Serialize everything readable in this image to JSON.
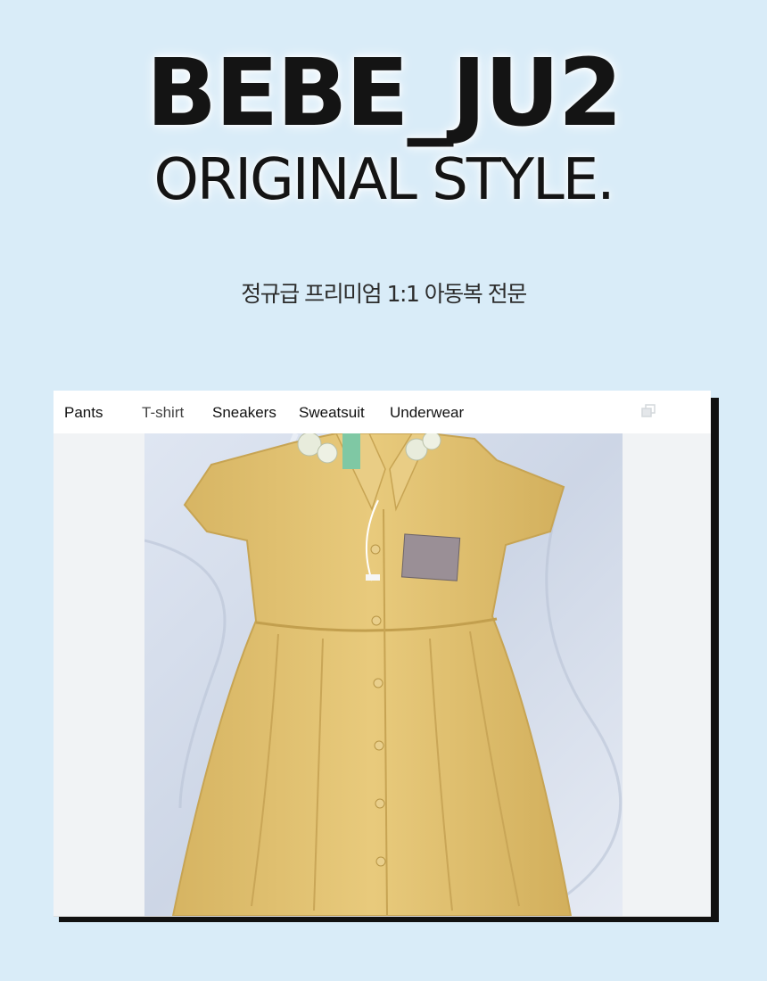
{
  "header": {
    "brand_title": "BEBE_JU2",
    "brand_subtitle": "ORIGINAL STYLE.",
    "tagline": "정규급 프리미엄 1:1 아동복 전문"
  },
  "tabs": [
    {
      "label": "Pants"
    },
    {
      "label": "T-shirt"
    },
    {
      "label": "Sneakers"
    },
    {
      "label": "Sweatsuit"
    },
    {
      "label": "Underwear"
    }
  ],
  "active_tab": "T-shirt",
  "icons": {
    "copy": "copy-icon"
  },
  "colors": {
    "background": "#d9ecf8",
    "card_shadow": "#111111",
    "dress": "#e2c272"
  }
}
